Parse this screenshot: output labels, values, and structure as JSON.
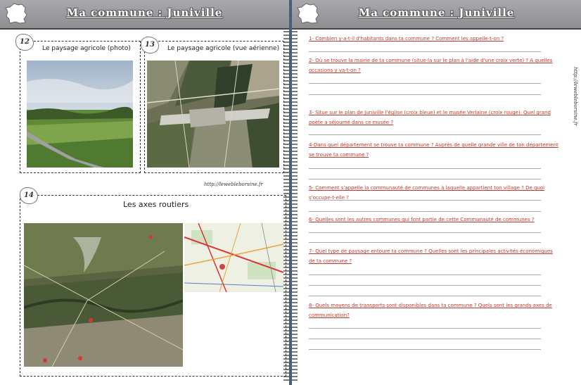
{
  "left": {
    "title": "Ma commune : Juniville",
    "sections": [
      {
        "num": "12",
        "caption": "Le paysage agricole (photo)"
      },
      {
        "num": "13",
        "caption": "Le paysage agricole (vue aérienne)"
      },
      {
        "num": "14",
        "caption": "Les axes routiers"
      }
    ],
    "url": "http://lewebleborsine.fr"
  },
  "right": {
    "title": "Ma commune : Juniville",
    "url_vertical": "http://lewebleborsine.fr",
    "questions": [
      "1- Combien y-a-t-il d'habitants dans ta commune ? Comment les appelle-t-on ?",
      "2- Où se trouve la mairie de ta commune (situe-la sur le plan à l'aide d'une croix verte) ? A quelles occasions y va-t-on ?",
      "3- Situe sur le plan de Juniville l'église (croix bleue) et le musée Verlaine (croix rouge). Quel grand poète a séjourné dans ce musée ?",
      "4-Dans quel département se trouve ta commune ? Auprès de quelle grande ville de ton département se trouve ta commune ?",
      "5- Comment s'appelle la communauté de communes à laquelle appartient ton village ? De quoi s'occupe-t-elle ?",
      "6- Quelles sont les autres communes qui font partie de cette Communauté de communes ?",
      "7- Quel type de paysage entoure ta commune ? Quelles sont les principales activités économiques de ta commune ?",
      "8- Quels moyens de transports sont disponibles dans ta commune ? Quels sont les grands axes de communication?"
    ]
  }
}
